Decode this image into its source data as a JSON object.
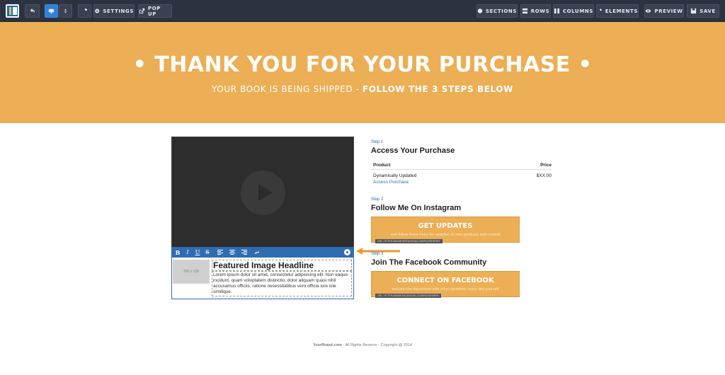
{
  "toolbar": {
    "undo_icon": "undo-icon",
    "device_icon": "desktop-icon",
    "settings_label": "SETTINGS",
    "popup_label": "POP UP",
    "sections_label": "SECTIONS",
    "rows_label": "ROWS",
    "columns_label": "COLUMNS",
    "elements_label": "ELEMENTS",
    "preview_label": "PREVIEW",
    "save_label": "SAVE",
    "active_color": "#2f80d6"
  },
  "hero": {
    "title": "• THANK YOU FOR YOUR PURCHASE •",
    "subtitle_normal": "YOUR BOOK IS BEING SHIPPED - ",
    "subtitle_bold": "FOLLOW THE 3 STEPS BELOW",
    "background": "#ecaf55"
  },
  "editor": {
    "tools": [
      "B",
      "I",
      "U",
      "S"
    ],
    "thumb_label": "300 x 238",
    "headline": "Featured Image Headline",
    "body": "Lorem ipsum dolor sit amet, consectetur adipisicing elit. Non eaque incidunt, quam voluptatem distinctio, dolor aliquam quasi nihil accusamus officiis, ratione necessitatibus vero officia iure iste similique."
  },
  "steps": [
    {
      "label": "Step 1",
      "title": "Access Your Purchase",
      "table": {
        "headers": [
          "Product",
          "Price"
        ],
        "rows": [
          {
            "product": "Dynamically Updated",
            "link": "Access Purchase",
            "price": "$XX.00"
          }
        ]
      }
    },
    {
      "label": "Step 2",
      "title": "Follow Me On Instagram",
      "button": "GET UPDATES",
      "button_sub": "and follow Russ Perry for updates on new products and content",
      "url": "URL: HTTPS://WWW.INSTAGRAM.COM/RUSSPERRY"
    },
    {
      "label": "Step 3",
      "title": "Join The Facebook Community",
      "button": "CONNECT ON FACEBOOK",
      "button_sub": "and join the discussion with other members much like yourself",
      "url": "URL: HTTPS://WWW.FACEBOOK.COM/RUSSPERRY"
    }
  ],
  "footer": {
    "brand": "YourBrand.com",
    "rest": " - All Rights Reserve - Copyright @ 2014"
  }
}
